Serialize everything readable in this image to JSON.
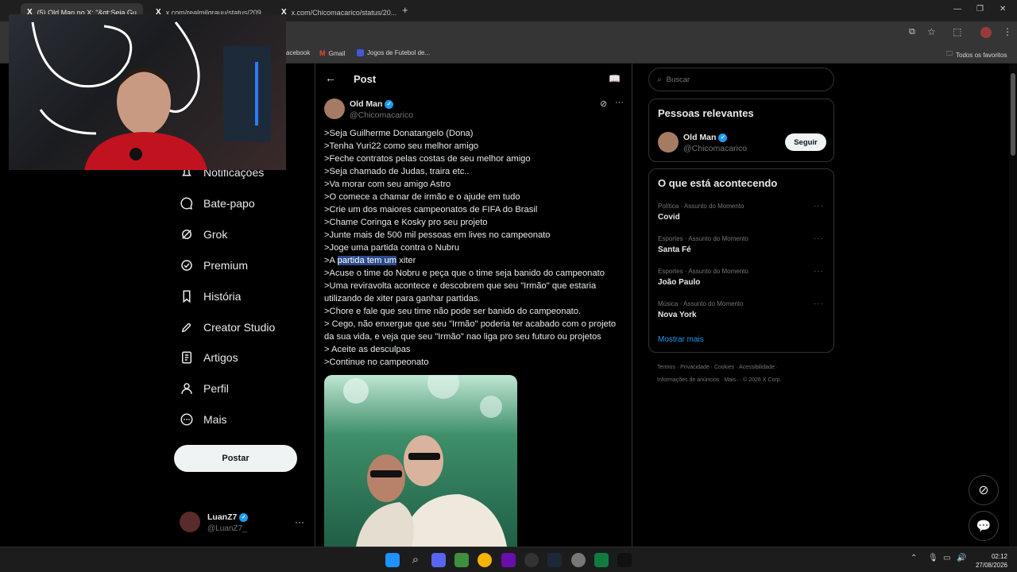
{
  "browser": {
    "tabs": [
      {
        "label": "(5) Old Man no X: \"&qt;Seja Gu..."
      },
      {
        "label": "x.com/realmilgrauu/status/209..."
      },
      {
        "label": "x.com/Chicomacarico/status/20..."
      }
    ],
    "new_tab": "+",
    "bookmarks": [
      {
        "label": "acebook"
      },
      {
        "label": "Gmail"
      },
      {
        "label": "Jogos de Futebol de..."
      }
    ],
    "all_favorites": "Todos os favoritos"
  },
  "sidebar": {
    "items": [
      {
        "label": "Notificações",
        "icon": "bell-icon"
      },
      {
        "label": "Bate-papo",
        "icon": "chat-icon"
      },
      {
        "label": "Grok",
        "icon": "grok-icon"
      },
      {
        "label": "Premium",
        "icon": "premium-icon"
      },
      {
        "label": "História",
        "icon": "bookmark-icon"
      },
      {
        "label": "Creator Studio",
        "icon": "rocket-icon"
      },
      {
        "label": "Artigos",
        "icon": "article-icon"
      },
      {
        "label": "Perfil",
        "icon": "person-icon"
      },
      {
        "label": "Mais",
        "icon": "more-circle-icon"
      }
    ],
    "post_button": "Postar",
    "account": {
      "name": "LuanZ7",
      "handle": "@LuanZ7_"
    }
  },
  "post": {
    "header": "Post",
    "author": {
      "name": "Old Man",
      "handle": "@Chicomacarico"
    },
    "lines": [
      ">Seja Guilherme Donatangelo (Dona)",
      ">Tenha Yuri22 como seu melhor amigo",
      ">Feche contratos pelas costas de seu melhor amigo",
      ">Seja chamado de Judas, traira etc..",
      ">Va morar com seu amigo Astro",
      ">O comece a chamar de irmão e o ajude em tudo",
      ">Crie um dos maiores campeonatos de FIFA do Brasil",
      ">Chame Coringa e Kosky pro seu projeto",
      ">Junte mais de 500 mil pessoas em lives no campeonato",
      ">Joge uma partida contra o Nubru"
    ],
    "highlight_line": {
      "prefix": ">A ",
      "highlight": "partida tem um",
      "suffix": " xiter"
    },
    "lines_after": [
      ">Acuse o time do Nobru e peça que o time seja banido do campeonato",
      ">Uma reviravolta acontece e descobrem que seu \"Irmão\" que estaria",
      "utilizando de xiter para ganhar partidas.",
      ">Chore e fale que seu time não pode ser banido do campeonato.",
      "> Cego, não enxergue que seu \"Irmão\" poderia ter acabado com o projeto",
      "da sua vida, e veja que seu \"Irmão\" nao liga pro seu futuro ou projetos",
      "> Aceite as desculpas",
      ">Continue no campeonato"
    ]
  },
  "search": {
    "placeholder": "Buscar"
  },
  "relevant": {
    "title": "Pessoas relevantes",
    "name": "Old Man",
    "handle": "@Chicomacarico",
    "follow": "Seguir"
  },
  "trends": {
    "title": "O que está acontecendo",
    "items": [
      {
        "meta": "Política · Assunto do Momento",
        "title": "Covid"
      },
      {
        "meta": "Esportes · Assunto do Momento",
        "title": "Santa Fé"
      },
      {
        "meta": "Esportes · Assunto do Momento",
        "title": "João Paulo"
      },
      {
        "meta": "Música · Assunto do Momento",
        "title": "Nova York"
      }
    ],
    "show_more": "Mostrar mais"
  },
  "footer": {
    "line1": "Termos · Privacidade · Cookies · Acessibilidade ·",
    "line2": "Informações de anúncios · Mais··· © 2026 X Corp."
  },
  "clock": {
    "time": "02:12",
    "date": "27/08/2026"
  },
  "colors": {
    "accent": "#1d9bf0",
    "highlight": "#2c4a8a",
    "background": "#000000"
  }
}
